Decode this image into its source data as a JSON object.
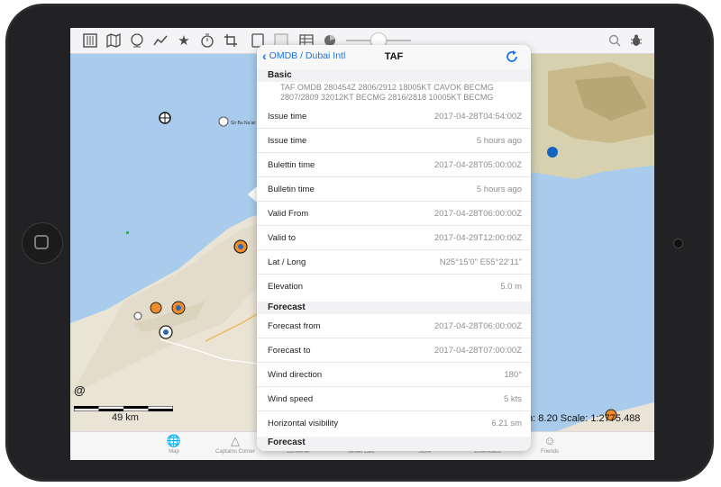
{
  "toolbar": {
    "icons": [
      "sliders-icon",
      "map-icon",
      "globe-icon",
      "route-icon",
      "star-icon",
      "timer-icon",
      "crop-icon",
      "tablet-icon",
      "checkbox-icon",
      "table-icon",
      "radar-icon",
      "search-icon",
      "bug-icon"
    ]
  },
  "popover": {
    "back_label": "OMDB / Dubai Intl",
    "title": "TAF",
    "sections": [
      {
        "header": "Basic",
        "raw_text": "TAF OMDB 280454Z 2806/2912 18005KT CAVOK BECMG 2807/2809 32012KT BECMG 2816/2818 10005KT BECMG",
        "rows": [
          {
            "label": "Issue time",
            "value": "2017-04-28T04:54:00Z"
          },
          {
            "label": "Issue time",
            "value": "5 hours ago"
          },
          {
            "label": "Bulettin time",
            "value": "2017-04-28T05:00:00Z"
          },
          {
            "label": "Bulletin time",
            "value": "5 hours ago"
          },
          {
            "label": "Valid From",
            "value": "2017-04-28T06:00:00Z"
          },
          {
            "label": "Valid to",
            "value": "2017-04-29T12:00:00Z"
          },
          {
            "label": "Lat / Long",
            "value": "N25°15'0\"   E55°22'11\""
          },
          {
            "label": "Elevation",
            "value": "5.0 m"
          }
        ]
      },
      {
        "header": "Forecast",
        "rows": [
          {
            "label": "Forecast from",
            "value": "2017-04-28T06:00:00Z"
          },
          {
            "label": "Forecast to",
            "value": "2017-04-28T07:00:00Z"
          },
          {
            "label": "Wind direction",
            "value": "180°"
          },
          {
            "label": "Wind speed",
            "value": "5 kts"
          },
          {
            "label": "Horizontal visibility",
            "value": "6.21 sm"
          }
        ]
      },
      {
        "header": "Forecast"
      }
    ]
  },
  "map": {
    "scale_distance": "49 km",
    "zoom_scale": "m: 8.20  Scale: 1:2775.488",
    "at_symbol": "@",
    "marker_color": "#1565c0"
  },
  "tabbar": {
    "items": [
      {
        "label": "Map",
        "icon": "globe-icon"
      },
      {
        "label": "Captains Corner",
        "icon": "cap-icon"
      },
      {
        "label": "Converter",
        "icon": "converter-icon"
      },
      {
        "label": "Jetset Calc",
        "icon": "calculator-icon"
      },
      {
        "label": "Store",
        "icon": "store-icon"
      },
      {
        "label": "Downloads",
        "icon": "download-icon"
      },
      {
        "label": "Friends",
        "icon": "friends-icon"
      }
    ]
  }
}
